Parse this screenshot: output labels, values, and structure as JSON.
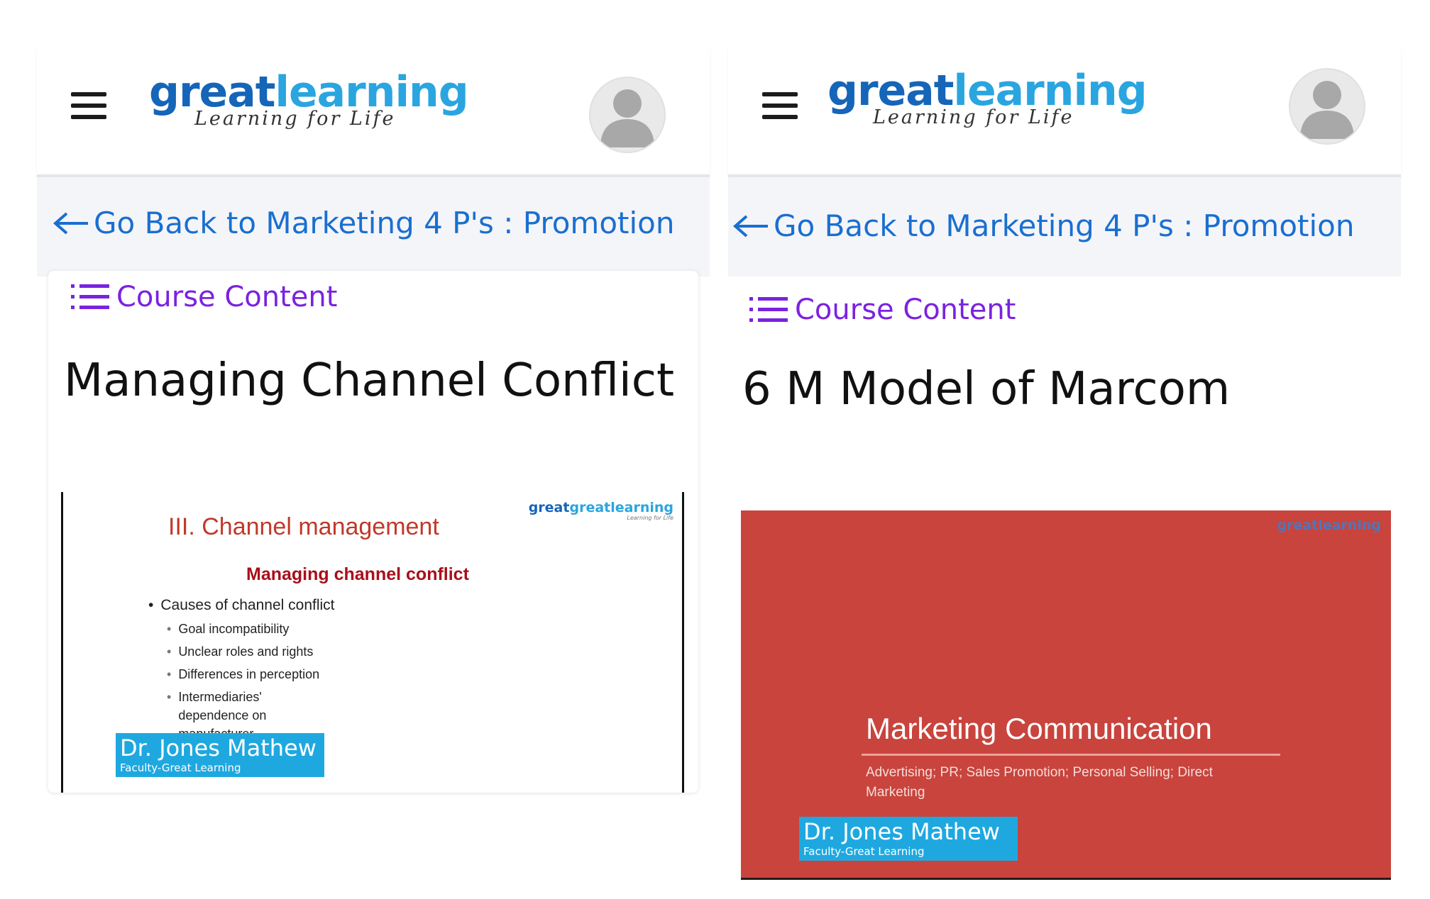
{
  "app": {
    "logo_great": "great",
    "logo_learning": "learning",
    "logo_tagline": "Learning for Life"
  },
  "panels": [
    {
      "back_link": "Go Back to Marketing 4 P's : Promotion",
      "course_content": "Course Content",
      "lesson_title": "Managing Channel Conflict",
      "slide": {
        "logo": "greatlearning",
        "logo_tagline": "Learning for Life",
        "heading": "III. Channel management",
        "subheading": "Managing channel conflict",
        "bullet_main": "Causes of channel conflict",
        "bullets": [
          "Goal incompatibility",
          "Unclear roles and rights",
          "Differences in perception",
          "Intermediaries' dependence on manufacturer"
        ],
        "presenter_name": "Dr. Jones Mathew",
        "presenter_role": "Faculty-Great Learning"
      }
    },
    {
      "back_link": "Go Back to Marketing 4 P's : Promotion",
      "course_content": "Course Content",
      "lesson_title": "6 M Model of Marcom",
      "slide": {
        "logo": "greatlearning",
        "title": "Marketing Communication",
        "subtitle": "Advertising; PR; Sales Promotion; Personal Selling; Direct Marketing",
        "presenter_name": "Dr. Jones Mathew",
        "presenter_role": "Faculty-Great Learning"
      }
    }
  ],
  "icons": {
    "menu": "hamburger-menu-icon",
    "avatar": "user-avatar-icon",
    "back": "arrow-left-icon",
    "course_content": "list-icon"
  },
  "colors": {
    "link_blue": "#1a6fd0",
    "course_purple": "#7b22e0",
    "brand_dark_blue": "#1565b8",
    "brand_light_blue": "#2aa5e0",
    "slide_red": "#c8443d",
    "badge_blue": "#1fa8e0"
  }
}
